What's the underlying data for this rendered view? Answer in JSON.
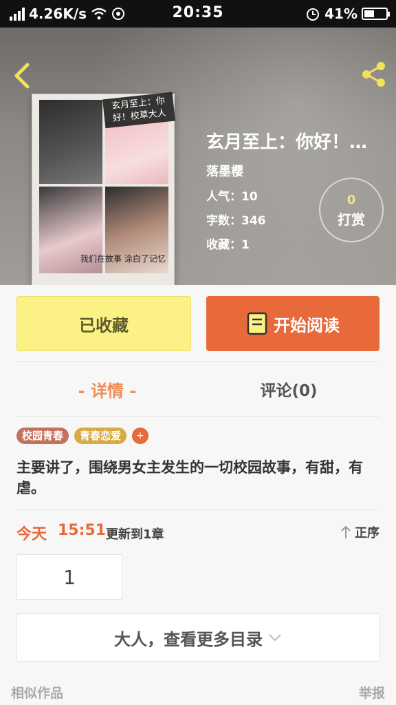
{
  "status_bar": {
    "speed": "4.26K/s",
    "time": "20:35",
    "battery": "41%"
  },
  "book": {
    "title": "玄月至上：你好！…",
    "author": "落墨樱",
    "popularity": "人气：10",
    "word_count": "字数：346",
    "favorites": "收藏：1",
    "reward_count": "0",
    "reward_label": "打赏",
    "cover_caption": "玄月至上：你好！校草大人",
    "cover_handwriting": "我们在故事 涂白了记忆"
  },
  "actions": {
    "favorited_label": "已收藏",
    "read_label": "开始阅读"
  },
  "tabs": {
    "detail": "- 详情 -",
    "comments": "评论(0)"
  },
  "tags": [
    "校园青春",
    "青春恋爱"
  ],
  "tag_more": "+",
  "description": "主要讲了，围绕男女主发生的一切校园故事，有甜，有虐。",
  "update": {
    "day": "今天",
    "time": "15:51",
    "text": "更新到1章",
    "order": "正序"
  },
  "chapters": [
    "1"
  ],
  "more_catalog": "大人，查看更多目录",
  "footer": {
    "similar": "相似作品",
    "report": "举报"
  },
  "colors": {
    "accent": "#e8693a",
    "favorite": "#fbf184",
    "tab_active": "#f08d55"
  }
}
